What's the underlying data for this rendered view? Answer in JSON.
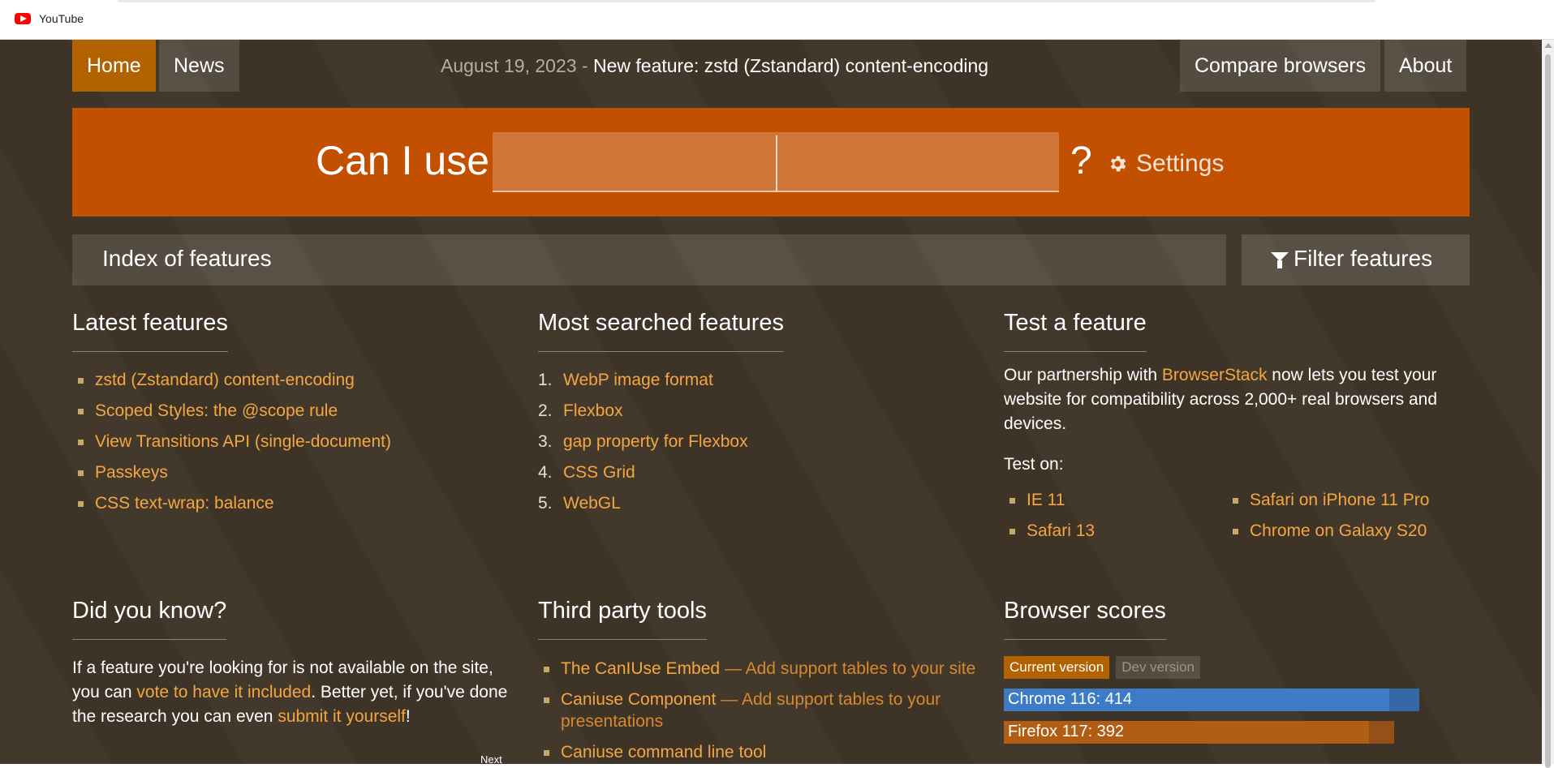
{
  "bookmark_bar": {
    "item_label": "YouTube"
  },
  "nav": {
    "home": "Home",
    "news": "News",
    "news_date": "August 19, 2023",
    "news_separator": " - ",
    "news_title": "New feature: zstd (Zstandard) content-encoding",
    "compare": "Compare browsers",
    "about": "About"
  },
  "hero": {
    "label": "Can I use",
    "search_value": "",
    "question_mark": "?",
    "settings": "Settings"
  },
  "index": {
    "label": "Index of features",
    "filter": "Filter features"
  },
  "latest": {
    "title": "Latest features",
    "items": [
      "zstd (Zstandard) content-encoding",
      "Scoped Styles: the @scope rule",
      "View Transitions API (single-document)",
      "Passkeys",
      "CSS text-wrap: balance"
    ]
  },
  "most_searched": {
    "title": "Most searched features",
    "items": [
      {
        "num": "1.",
        "label": "WebP image format"
      },
      {
        "num": "2.",
        "label": "Flexbox"
      },
      {
        "num": "3.",
        "label": "gap property for Flexbox"
      },
      {
        "num": "4.",
        "label": "CSS Grid"
      },
      {
        "num": "5.",
        "label": "WebGL"
      }
    ]
  },
  "test": {
    "title": "Test a feature",
    "text_before": "Our partnership with ",
    "link": "BrowserStack",
    "text_after": " now lets you test your website for compatibility across 2,000+ real browsers and devices.",
    "test_on": "Test on:",
    "items": [
      "IE 11",
      "Safari on iPhone 11 Pro",
      "Safari 13",
      "Chrome on Galaxy S20"
    ]
  },
  "did_you_know": {
    "title": "Did you know?",
    "p1": "If a feature you're looking for is not available on the site, you can ",
    "link1": "vote to have it included",
    "p2": ". Better yet, if you've done the research you can even ",
    "link2": "submit it yourself",
    "p3": "!",
    "next": "Next"
  },
  "third_party": {
    "title": "Third party tools",
    "items": [
      {
        "name": "The CanIUse Embed",
        "desc": " — Add support tables to your site"
      },
      {
        "name": "Caniuse Component",
        "desc": " — Add support tables to your presentations"
      },
      {
        "name": "Caniuse command line tool",
        "desc": ""
      }
    ]
  },
  "scores": {
    "title": "Browser scores",
    "current": "Current version",
    "dev": "Dev version",
    "rows": [
      {
        "label": "Chrome 116: 414",
        "value": 414,
        "max": 446,
        "color": "#3d7bc6",
        "track_color": "#3568a8"
      },
      {
        "label": "Firefox 117: 392",
        "value": 392,
        "max": 419,
        "color": "#b25d14",
        "track_color": "#945016"
      }
    ]
  },
  "colors": {
    "accent": "#c25000",
    "link": "#f5a640",
    "active_nav": "#b26200"
  }
}
